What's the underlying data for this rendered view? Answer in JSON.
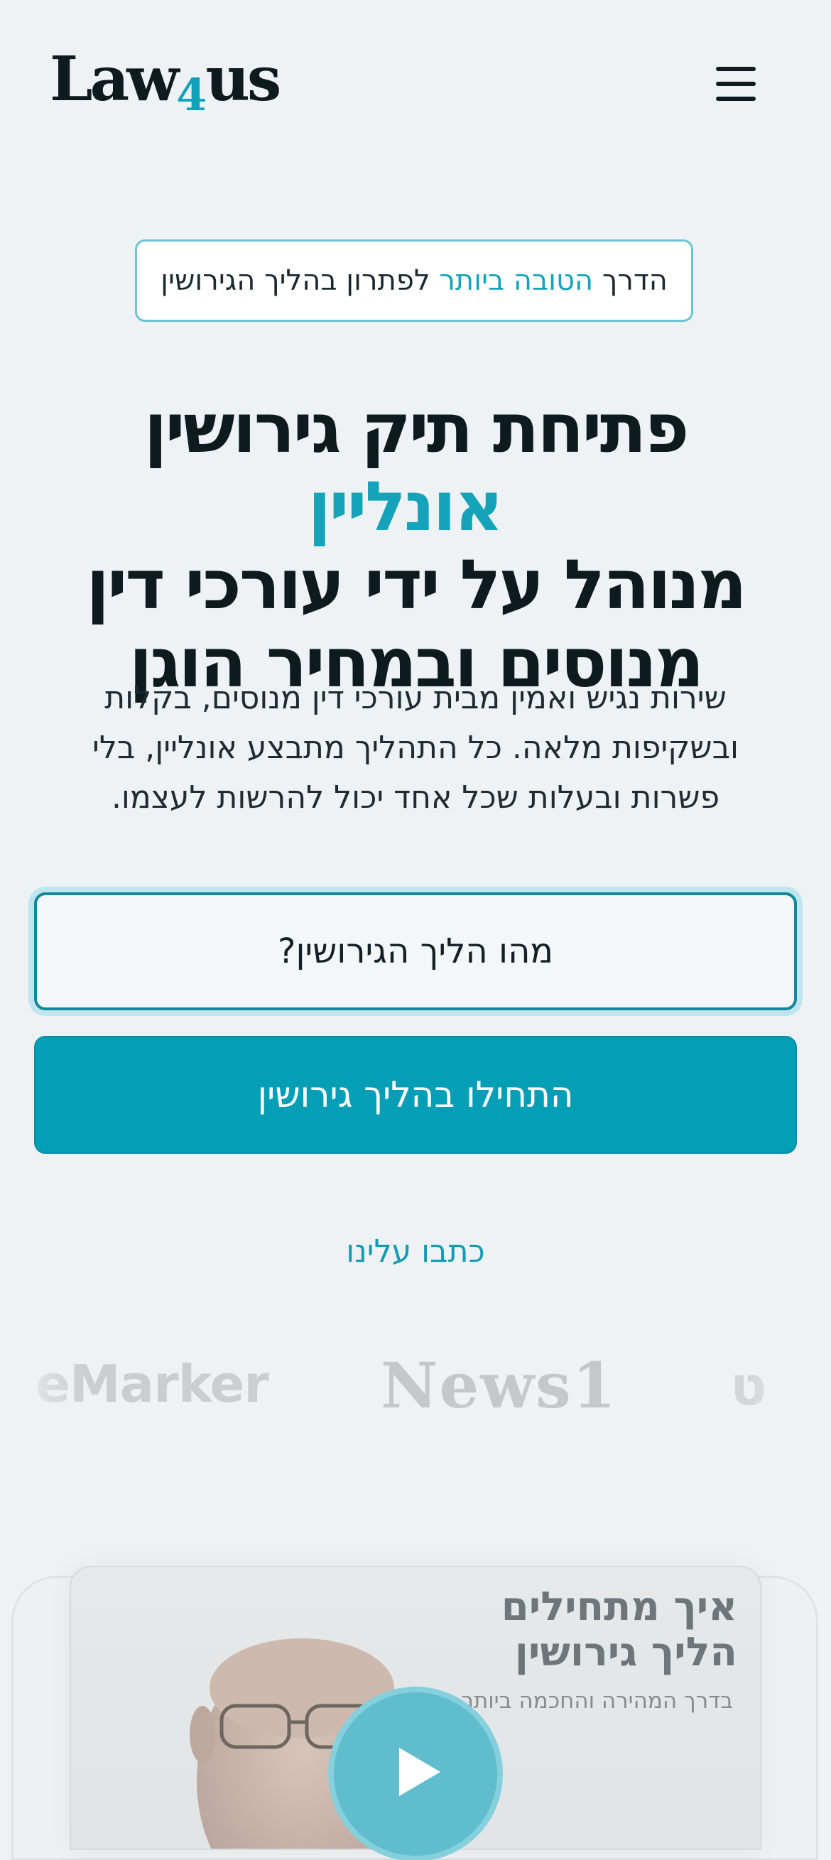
{
  "header": {
    "logo_prefix": "Law",
    "logo_four": "4",
    "logo_suffix": "us",
    "menu_icon": "hamburger-icon"
  },
  "badge": {
    "part1": "הדרך ",
    "accent": "הטובה ביותר",
    "part2": " לפתרון בהליך הגירושין"
  },
  "hero": {
    "line1_text": "פתיחת תיק גירושין ",
    "line1_accent": "אונליין",
    "line2": "מנוהל על ידי עורכי דין",
    "line3": "מנוסים ובמחיר הוגן",
    "description": "שירות נגיש ואמין מבית עורכי דין מנוסים, בקלות ובשקיפות מלאה. כל התהליך מתבצע אונליין, בלי פשרות ובעלות שכל אחד יכול להרשות לעצמו."
  },
  "buttons": {
    "what_is": "מהו הליך הגירושין?",
    "start": "התחילו בהליך גירושין",
    "press_link": "כתבו עלינו"
  },
  "press": {
    "logo1": "eMarker",
    "logo2": "News1",
    "logo3": "ט"
  },
  "video_card": {
    "title_line1": "איך מתחילים",
    "title_line2": "הליך גירושין",
    "subtitle": "בדרך המהירה והחכמה ביותר",
    "play_icon": "play-icon"
  },
  "colors": {
    "accent": "#14a3b8",
    "primary_button": "#049fb7",
    "background": "#eff2f4",
    "text": "#0d1a1e"
  }
}
